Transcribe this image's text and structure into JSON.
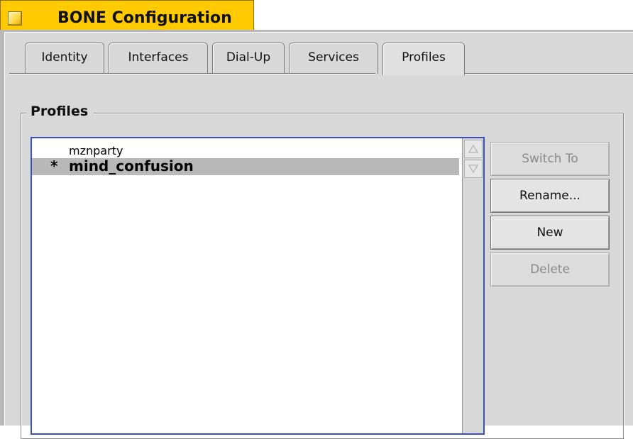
{
  "window": {
    "title": "BONE Configuration"
  },
  "tabs": [
    {
      "label": "Identity",
      "active": false
    },
    {
      "label": "Interfaces",
      "active": false
    },
    {
      "label": "Dial-Up",
      "active": false
    },
    {
      "label": "Services",
      "active": false
    },
    {
      "label": "Profiles",
      "active": true
    }
  ],
  "profiles": {
    "group_label": "Profiles",
    "items": [
      {
        "marker": "",
        "name": "mznparty",
        "selected": false,
        "current": false
      },
      {
        "marker": "*",
        "name": "mind_confusion",
        "selected": true,
        "current": true
      }
    ],
    "buttons": {
      "switch_to": "Switch To",
      "rename": "Rename...",
      "new": "New",
      "delete": "Delete"
    }
  },
  "icons": {
    "close": "close-box-icon",
    "scroll_up": "triangle-up-icon",
    "scroll_down": "triangle-down-icon"
  },
  "colors": {
    "title_tab": "#ffcb00",
    "panel": "#d8d8d8",
    "list_focus_border": "#3b4fbf",
    "selection": "#b8b8b8"
  }
}
